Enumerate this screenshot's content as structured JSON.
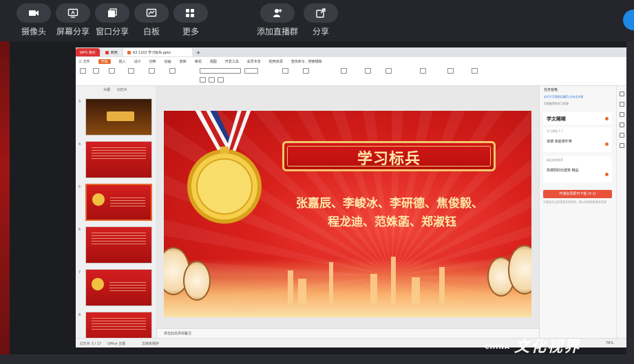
{
  "toolbar": {
    "items": [
      {
        "label": "摄像头",
        "icon": "camera-icon"
      },
      {
        "label": "屏幕分享",
        "icon": "screen-share-icon"
      },
      {
        "label": "窗口分享",
        "icon": "window-share-icon"
      },
      {
        "label": "白板",
        "icon": "whiteboard-icon"
      },
      {
        "label": "更多",
        "icon": "grid-icon"
      },
      {
        "label": "添加直播群",
        "icon": "add-group-icon"
      },
      {
        "label": "分享",
        "icon": "share-icon"
      }
    ]
  },
  "wps": {
    "tab_app": "WPS 演示",
    "tab_doc1": "稿壳",
    "tab_doc2": "A3 1102 学习标兵.pptx",
    "menu": [
      "三 文件",
      "开始",
      "插入",
      "设计",
      "切换",
      "动画",
      "放映",
      "审阅",
      "视图",
      "开发工具",
      "会员专享",
      "稻壳资源",
      "查找命令、搜索模板"
    ],
    "menu_active": "开始",
    "thumb_tabs": [
      "大纲",
      "幻灯片"
    ],
    "thumb_numbers": [
      "3",
      "4",
      "5",
      "6",
      "7",
      "8"
    ],
    "notes_placeholder": "单击此处添加备注",
    "status": {
      "slide_count": "幻灯片 3 / 17",
      "theme": "Office 主题",
      "spell": "文档未保护",
      "zoom": "78%"
    }
  },
  "slide": {
    "title": "学习标兵",
    "names_line1": "张嘉辰、李峻冰、李研德、焦俊毅、",
    "names_line2": "程龙迪、范姝菡、郑淑钰"
  },
  "right_panel": {
    "header": "任务窗格",
    "link": "幻灯片页面前后翻页·点击全文档",
    "section1": "为您推荐的学习资源",
    "card1_title": "学文稀稀",
    "card2_small": "学习课程 1·2",
    "card2_line": "道德·家庭课件堆",
    "card3_small": "精品课程推荐",
    "card3_line": "高楼阳的石建筑 精品",
    "button": "开通会员即可下载 (¥·1)",
    "note": "开通会员立即享受多项特权，随心所欲获取更多资源"
  },
  "watermark": {
    "small": "CHINA",
    "text": "文化视界"
  }
}
